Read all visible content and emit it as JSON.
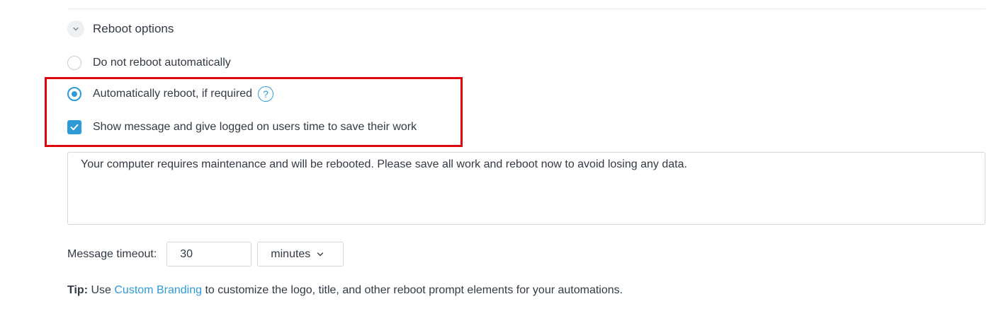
{
  "section": {
    "title": "Reboot options",
    "toggle_icon": "chevron-down-icon"
  },
  "options": {
    "no_reboot_label": "Do not reboot automatically",
    "no_reboot_selected": false,
    "auto_reboot_label": "Automatically reboot, if required",
    "auto_reboot_selected": true,
    "help_glyph": "?",
    "show_message_label": "Show message and give logged on users time to save their work",
    "show_message_checked": true
  },
  "message": {
    "text": "Your computer requires maintenance and will be rebooted. Please save all work and reboot now to avoid losing any data."
  },
  "timeout": {
    "label": "Message timeout:",
    "value": "30",
    "unit": "minutes"
  },
  "tip": {
    "prefix": "Tip:",
    "before_link": " Use ",
    "link": "Custom Branding",
    "after_link": " to customize the logo, title, and other reboot prompt elements for your automations."
  },
  "colors": {
    "accent": "#2f9bd6",
    "highlight": "#e0060c",
    "text": "#333a44",
    "border": "#d4d8de"
  }
}
